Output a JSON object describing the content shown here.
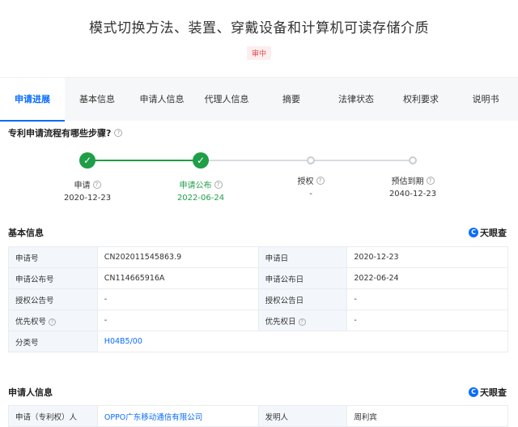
{
  "header": {
    "title": "模式切换方法、装置、穿戴设备和计算机可读存储介质",
    "status": "审中"
  },
  "tabs": [
    "申请进展",
    "基本信息",
    "申请人信息",
    "代理人信息",
    "摘要",
    "法律状态",
    "权利要求",
    "说明书"
  ],
  "flow": {
    "question": "专利申请流程有哪些步骤?",
    "steps": [
      {
        "label": "申请",
        "date": "2020-12-23"
      },
      {
        "label": "申请公布",
        "date": "2022-06-24"
      },
      {
        "label": "授权",
        "date": "-"
      },
      {
        "label": "预估到期",
        "date": "2040-12-23"
      }
    ]
  },
  "basic": {
    "title": "基本信息",
    "logo": "天眼查",
    "rows": [
      {
        "k1": "申请号",
        "v1": "CN202011545863.9",
        "k2": "申请日",
        "v2": "2020-12-23"
      },
      {
        "k1": "申请公布号",
        "v1": "CN114665916A",
        "k2": "申请公布日",
        "v2": "2022-06-24"
      },
      {
        "k1": "授权公告号",
        "v1": "-",
        "k2": "授权公告日",
        "v2": "-"
      },
      {
        "k1": "优先权号",
        "v1": "-",
        "k2": "优先权日",
        "v2": "-"
      }
    ],
    "class_key": "分类号",
    "class_value": "H04B5/00"
  },
  "applicant": {
    "title": "申请人信息",
    "logo": "天眼查",
    "k1": "申请（专利权）人",
    "v1": "OPPO广东移动通信有限公司",
    "k2": "发明人",
    "v2": "周利宾"
  }
}
